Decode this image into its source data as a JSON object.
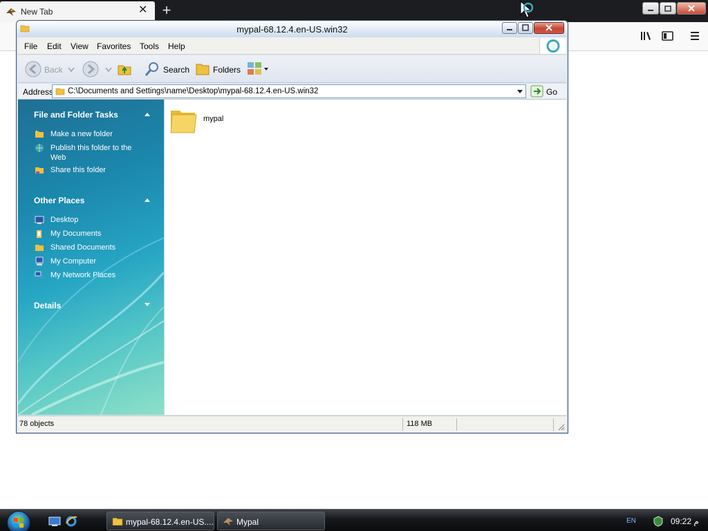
{
  "browser": {
    "tab_title": "New Tab",
    "new_tab_symbol": "+"
  },
  "explorer": {
    "title": "mypal-68.12.4.en-US.win32",
    "menu": [
      "File",
      "Edit",
      "View",
      "Favorites",
      "Tools",
      "Help"
    ],
    "toolbar": {
      "back_label": "Back",
      "search_label": "Search",
      "folders_label": "Folders"
    },
    "address": {
      "label": "Address",
      "value": "C:\\Documents and Settings\\name\\Desktop\\mypal-68.12.4.en-US.win32",
      "go_label": "Go"
    },
    "task_pane": {
      "file_tasks_title": "File and Folder Tasks",
      "file_tasks": [
        {
          "label": "Make a new folder",
          "icon": "new-folder-icon"
        },
        {
          "label": "Publish this folder to the Web",
          "icon": "publish-web-icon"
        },
        {
          "label": "Share this folder",
          "icon": "share-folder-icon"
        }
      ],
      "other_places_title": "Other Places",
      "other_places": [
        {
          "label": "Desktop",
          "icon": "desktop-icon"
        },
        {
          "label": "My Documents",
          "icon": "my-documents-icon"
        },
        {
          "label": "Shared Documents",
          "icon": "shared-documents-icon"
        },
        {
          "label": "My Computer",
          "icon": "my-computer-icon"
        },
        {
          "label": "My Network Places",
          "icon": "network-places-icon"
        }
      ],
      "details_title": "Details"
    },
    "content": {
      "items": [
        {
          "name": "mypal",
          "icon": "folder-icon"
        }
      ]
    },
    "status": {
      "objects": "78 objects",
      "size": "118 MB"
    }
  },
  "taskbar": {
    "buttons": [
      {
        "label": "mypal-68.12.4.en-US....",
        "icon": "folder-icon"
      },
      {
        "label": "Mypal",
        "icon": "mypal-icon"
      }
    ],
    "language": "EN",
    "clock": "09:22 م"
  },
  "colors": {
    "task_pane_top": "#1f6f94",
    "task_pane_bottom": "#8ee0c8",
    "taskbar": "#16181b",
    "close_button": "#c44532"
  }
}
